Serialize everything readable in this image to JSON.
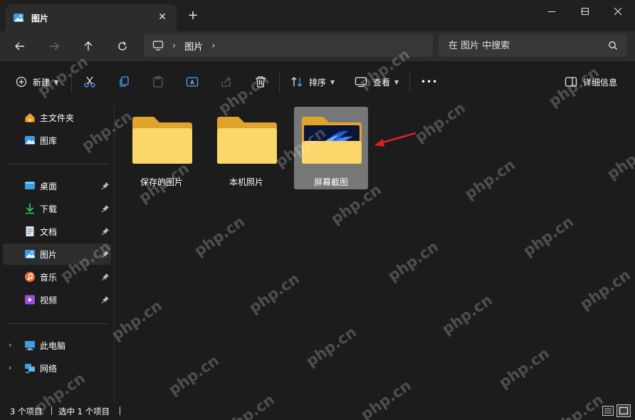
{
  "window": {
    "tab_title": "图片",
    "new_tab": "+",
    "tab_close": "✕"
  },
  "address": {
    "breadcrumbs": [
      "图片"
    ],
    "search_placeholder": "在 图片 中搜索"
  },
  "commands": {
    "new_label": "新建",
    "sort_label": "排序",
    "view_label": "查看",
    "more_label": "•••",
    "details_label": "详细信息"
  },
  "sidebar": {
    "top": [
      {
        "label": "主文件夹",
        "icon": "home-icon"
      },
      {
        "label": "图库",
        "icon": "gallery-icon"
      }
    ],
    "pinned": [
      {
        "label": "桌面",
        "icon": "desktop-icon"
      },
      {
        "label": "下载",
        "icon": "download-icon"
      },
      {
        "label": "文档",
        "icon": "documents-icon"
      },
      {
        "label": "图片",
        "icon": "pictures-icon",
        "selected": true
      },
      {
        "label": "音乐",
        "icon": "music-icon"
      },
      {
        "label": "视频",
        "icon": "videos-icon"
      }
    ],
    "bottom": [
      {
        "label": "此电脑",
        "icon": "this-pc-icon"
      },
      {
        "label": "网络",
        "icon": "network-icon"
      }
    ]
  },
  "folders": [
    {
      "name": "保存的图片"
    },
    {
      "name": "本机照片"
    },
    {
      "name": "屏幕截图",
      "selected": true
    }
  ],
  "status": {
    "item_count": "3 个项目",
    "selected_count": "选中 1 个项目"
  },
  "watermark": "php.cn",
  "colors": {
    "background": "#1c1c1c",
    "folder_yellow": "#f8c53a",
    "selected_folder_bg": "#777777",
    "annotation_arrow": "#e02020"
  }
}
